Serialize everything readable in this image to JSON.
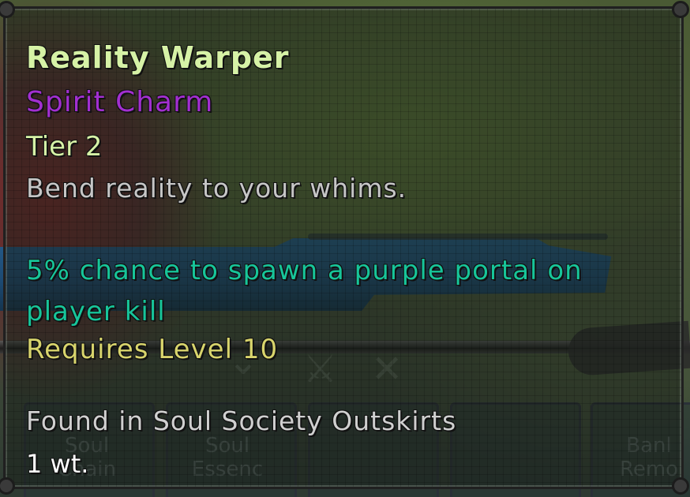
{
  "background": {
    "slots": [
      {
        "label_line1": "Soul",
        "label_line2": "Chain"
      },
      {
        "label_line1": "Soul",
        "label_line2": "Essenc"
      },
      {
        "label_line1": "",
        "label_line2": ""
      },
      {
        "label_line1": "",
        "label_line2": ""
      },
      {
        "label_line1": "Banl",
        "label_line2": "Remo"
      }
    ]
  },
  "tooltip": {
    "name": "Reality Warper",
    "type": "Spirit Charm",
    "tier": "Tier 2",
    "flavor": "Bend reality to your whims.",
    "effect": "5% chance to spawn a purple portal on player kill",
    "requirement": "Requires Level 10",
    "found_in": "Found in Soul Society Outskirts",
    "weight": "1 wt."
  },
  "colors": {
    "name": "#d6f2a6",
    "type": "#a22fd0",
    "effect": "#17c59a",
    "requirement": "#d8d46c",
    "flavor": "#c6c6c6"
  }
}
